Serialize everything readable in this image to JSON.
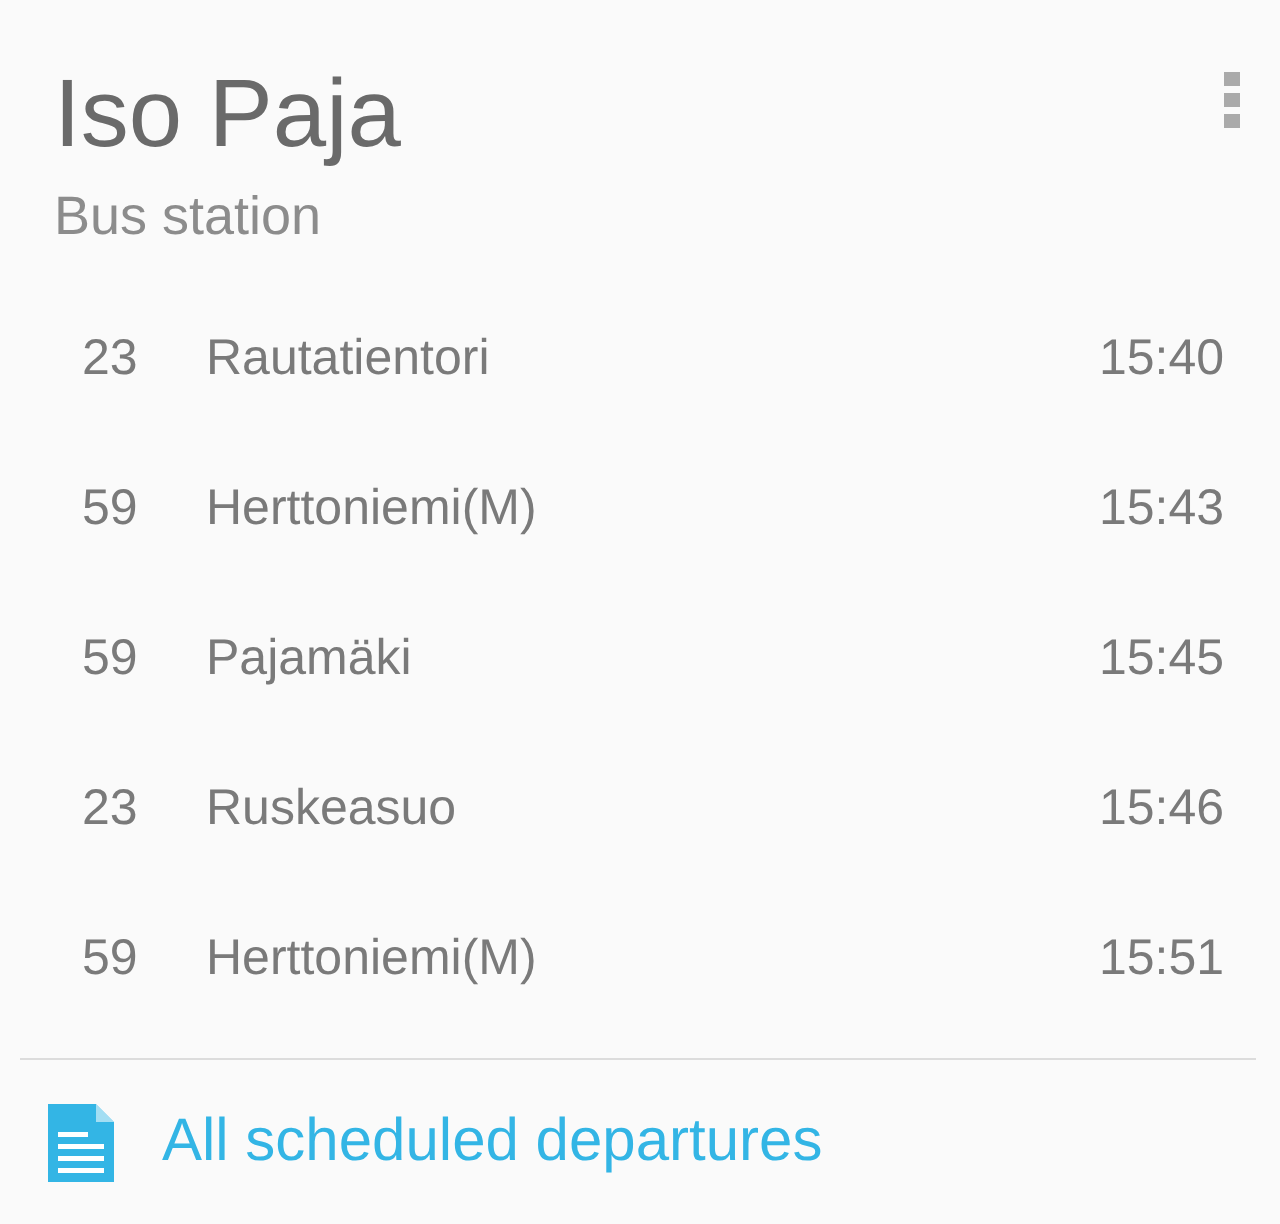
{
  "header": {
    "title": "Iso Paja",
    "subtitle": "Bus station"
  },
  "departures": [
    {
      "route": "23",
      "destination": "Rautatientori",
      "time": "15:40"
    },
    {
      "route": "59",
      "destination": "Herttoniemi(M)",
      "time": "15:43"
    },
    {
      "route": "59",
      "destination": "Pajamäki",
      "time": "15:45"
    },
    {
      "route": "23",
      "destination": "Ruskeasuo",
      "time": "15:46"
    },
    {
      "route": "59",
      "destination": "Herttoniemi(M)",
      "time": "15:51"
    }
  ],
  "footer_link": {
    "label": "All scheduled departures"
  }
}
